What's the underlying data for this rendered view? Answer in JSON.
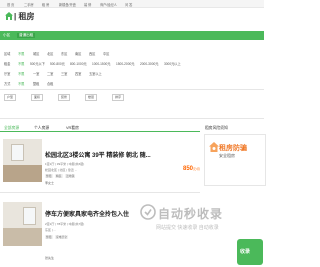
{
  "topnav": {
    "items": [
      "首 页",
      "二手房",
      "租 房",
      "新楼盘/开盘",
      "装 修",
      "商户/经纪人",
      "问 答"
    ]
  },
  "header": {
    "site_title": "| 租房"
  },
  "category_tabs": {
    "items": [
      "小区",
      "普通出租"
    ]
  },
  "filters": {
    "rows": [
      {
        "label": "区域",
        "options": [
          "不限",
          "城区",
          "北区",
          "东区",
          "南区",
          "西区",
          "中区"
        ]
      },
      {
        "label": "租金",
        "options": [
          "不限",
          "500元以下",
          "500-800元",
          "800-1000元",
          "1000-1500元",
          "1500-2000元",
          "2000-3000元",
          "3000元以上"
        ]
      },
      {
        "label": "厅室",
        "options": [
          "不限",
          "一室",
          "二室",
          "三室",
          "四室",
          "五室以上"
        ]
      },
      {
        "label": "方式",
        "options": [
          "不限",
          "整租",
          "合租"
        ]
      }
    ],
    "selects": [
      "户型",
      "面积",
      "装修",
      "楼层",
      "排序"
    ]
  },
  "list_tabs": {
    "items": [
      "全部房源",
      "个人房源",
      "VR看房"
    ],
    "side_title": "租房风险须知"
  },
  "listings": [
    {
      "title": "松园北区3楼公寓 39平 精装修 朝北 随...",
      "meta": "1室1厅  |  39平米  |  中层(共6层)",
      "meta2": "松园北区  |  北区  |  靠近 ...",
      "tags": [
        "整租",
        "精装",
        "近地铁"
      ],
      "price": "850",
      "price_unit": "元/月",
      "contact": "李女士"
    },
    {
      "title": "停车方便家具家电齐全拎包入住",
      "meta": "2室1厅  |  78平米  |  中层(共7层)",
      "meta2": "东区  |  ...",
      "tags": [
        "整租",
        "家电齐全"
      ],
      "price": "",
      "price_unit": "",
      "contact": "张先生"
    }
  ],
  "promo": {
    "title": "租房防骗",
    "subtitle": "安全租房"
  },
  "watermark": {
    "text": "自动秒收录",
    "subtitle": "网站提交 快速收录 自动收录"
  },
  "corner_logo": {
    "text": "收录"
  },
  "colors": {
    "accent": "#4bb95a",
    "price": "#ff6600"
  }
}
